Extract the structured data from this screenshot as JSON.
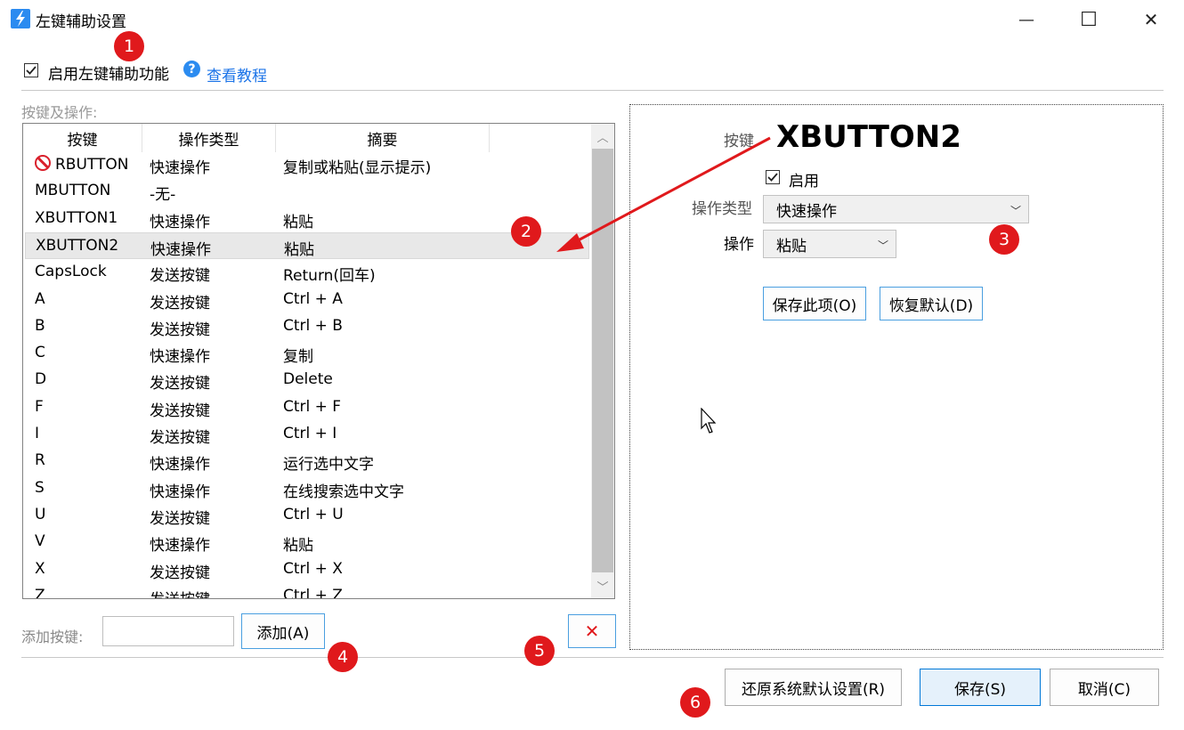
{
  "window": {
    "title": "左键辅助设置",
    "minimize_symbol": "—",
    "maximize_symbol": "☐",
    "close_symbol": "✕"
  },
  "enable": {
    "label": "启用左键辅助功能",
    "checked": true,
    "help_symbol": "?",
    "tutorial_link": "查看教程"
  },
  "list": {
    "section_label": "按键及操作:",
    "columns": [
      "按键",
      "操作类型",
      "摘要"
    ],
    "selected_index": 3,
    "rows": [
      {
        "key": "RBUTTON",
        "type": "快速操作",
        "summary": "复制或粘贴(显示提示)",
        "disabled_icon": true
      },
      {
        "key": "MBUTTON",
        "type": "-无-",
        "summary": ""
      },
      {
        "key": "XBUTTON1",
        "type": "快速操作",
        "summary": "粘贴"
      },
      {
        "key": "XBUTTON2",
        "type": "快速操作",
        "summary": "粘贴"
      },
      {
        "key": "CapsLock",
        "type": "发送按键",
        "summary": "Return(回车)"
      },
      {
        "key": "A",
        "type": "发送按键",
        "summary": "Ctrl + A"
      },
      {
        "key": "B",
        "type": "发送按键",
        "summary": "Ctrl + B"
      },
      {
        "key": "C",
        "type": "快速操作",
        "summary": "复制"
      },
      {
        "key": "D",
        "type": "发送按键",
        "summary": "Delete"
      },
      {
        "key": "F",
        "type": "发送按键",
        "summary": "Ctrl + F"
      },
      {
        "key": "I",
        "type": "发送按键",
        "summary": "Ctrl + I"
      },
      {
        "key": "R",
        "type": "快速操作",
        "summary": "运行选中文字"
      },
      {
        "key": "S",
        "type": "快速操作",
        "summary": "在线搜索选中文字"
      },
      {
        "key": "U",
        "type": "发送按键",
        "summary": "Ctrl + U"
      },
      {
        "key": "V",
        "type": "快速操作",
        "summary": "粘贴"
      },
      {
        "key": "X",
        "type": "发送按键",
        "summary": "Ctrl + X"
      },
      {
        "key": "Z",
        "type": "发送按键",
        "summary": "Ctrl + Z"
      }
    ]
  },
  "add": {
    "label": "添加按键:",
    "input_value": "",
    "add_button": "添加(A)",
    "delete_symbol": "✕"
  },
  "detail": {
    "key_label": "按键",
    "key_name": "XBUTTON2",
    "enable_label": "启用",
    "enable_checked": true,
    "type_label": "操作类型",
    "type_value": "快速操作",
    "action_label": "操作",
    "action_value": "粘贴",
    "save_item_button": "保存此项(O)",
    "restore_default_button": "恢复默认(D)"
  },
  "footer": {
    "restore_system_button": "还原系统默认设置(R)",
    "save_button": "保存(S)",
    "cancel_button": "取消(C)"
  },
  "annotations": [
    "1",
    "2",
    "3",
    "4",
    "5",
    "6"
  ],
  "colors": {
    "accent": "#2b8bf0",
    "annotation_red": "#e0191c",
    "link": "#1a73e8",
    "disabled_icon": "#d9202c"
  }
}
